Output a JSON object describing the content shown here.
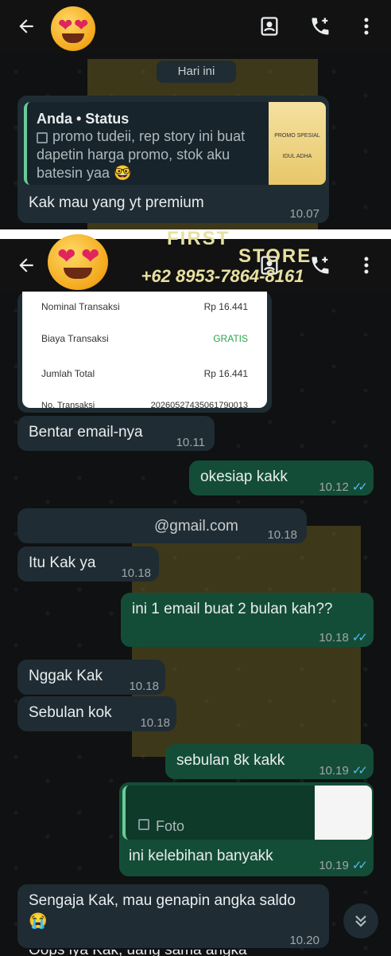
{
  "screen1": {
    "day_label": "Hari ini",
    "quote_author": "Anda • Status",
    "quote_text": "promo tudeii, rep story ini buat dapetin harga promo, stok aku batesin yaa 🤓",
    "message": "Kak mau yang yt premium",
    "message_time": "10.07",
    "thumb_label": "PROMO SPESIAL IDUL ADHA"
  },
  "screen2": {
    "receipt": {
      "rows": [
        {
          "label": "Nominal Transaksi",
          "value": "Rp 16.441"
        },
        {
          "label": "Biaya Transaksi",
          "value": "GRATIS"
        },
        {
          "label": "Jumlah Total",
          "value": "Rp 16.441"
        },
        {
          "label": "No. Transaksi",
          "value": "20260527435061790013"
        }
      ],
      "time": "10.11"
    },
    "messages": [
      {
        "text": "Bentar email-nya",
        "time": "10.11"
      },
      {
        "text": "okesiap kakk",
        "time": "10.12"
      },
      {
        "text": "@gmail.com",
        "time": "10.18"
      },
      {
        "text": "Itu Kak ya",
        "time": "10.18"
      },
      {
        "text": "ini 1 email buat 2 bulan kah??",
        "time": "10.18"
      },
      {
        "text": "Nggak Kak",
        "time": "10.18"
      },
      {
        "text": "Sebulan kok",
        "time": "10.18"
      },
      {
        "text": "sebulan 8k kakk",
        "time": "10.19"
      },
      {
        "text": "ini kelebihan banyakk",
        "time": "10.19",
        "quote": "Foto"
      },
      {
        "text": "Sengaja Kak, mau genapin angka saldo😭",
        "time": "10.20"
      },
      {
        "text": "Oops iya Kak, uang sama angka",
        "time": ""
      }
    ]
  },
  "watermark": {
    "line1": "FIRST",
    "line2": "STORE",
    "phone": "+62 8953-7864-8161"
  },
  "colors": {
    "incoming": "#1f2c33",
    "outgoing": "#144d37",
    "ticks": "#53bdeb"
  }
}
